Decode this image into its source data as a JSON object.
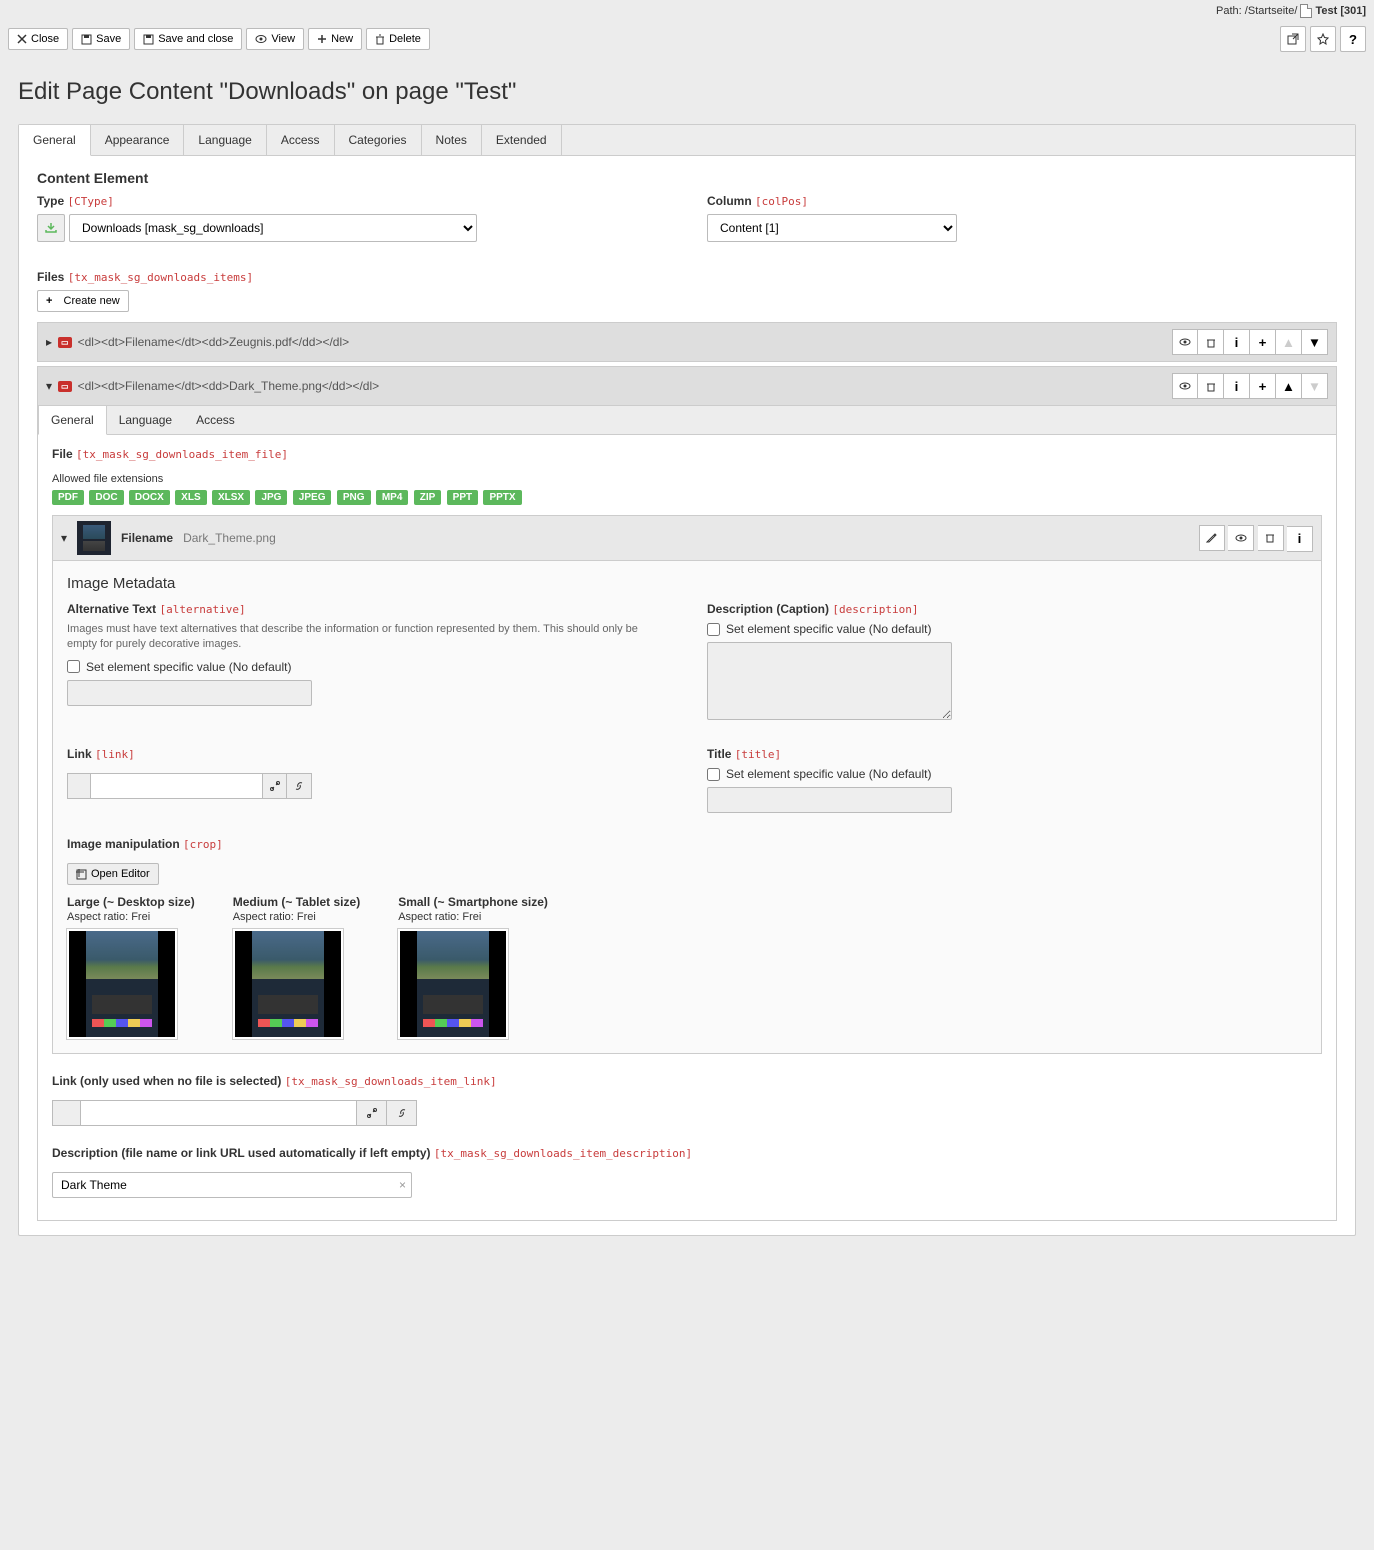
{
  "path": {
    "label": "Path:",
    "segment": "/Startseite/",
    "page": "Test",
    "uid": "[301]"
  },
  "toolbar": {
    "close": "Close",
    "save": "Save",
    "save_close": "Save and close",
    "view": "View",
    "new": "New",
    "delete": "Delete"
  },
  "heading": "Edit Page Content \"Downloads\" on page \"Test\"",
  "tabs": [
    "General",
    "Appearance",
    "Language",
    "Access",
    "Categories",
    "Notes",
    "Extended"
  ],
  "section_label": "Content Element",
  "type": {
    "label": "Type",
    "code": "[CType]",
    "value": "Downloads [mask_sg_downloads]"
  },
  "column": {
    "label": "Column",
    "code": "[colPos]",
    "value": "Content [1]"
  },
  "files": {
    "label": "Files",
    "code": "[tx_mask_sg_downloads_items]",
    "create": "Create new"
  },
  "collapsed_item": "<dl><dt>Filename</dt><dd>Zeugnis.pdf</dd></dl>",
  "expanded_item": "<dl><dt>Filename</dt><dd>Dark_Theme.png</dd></dl>",
  "sub_tabs": [
    "General",
    "Language",
    "Access"
  ],
  "file_field": {
    "label": "File",
    "code": "[tx_mask_sg_downloads_item_file]",
    "allowed_label": "Allowed file extensions",
    "ext": [
      "PDF",
      "DOC",
      "DOCX",
      "XLS",
      "XLSX",
      "JPG",
      "JPEG",
      "PNG",
      "MP4",
      "ZIP",
      "PPT",
      "PPTX"
    ]
  },
  "file_row": {
    "fn_label": "Filename",
    "fn": "Dark_Theme.png"
  },
  "meta": {
    "heading": "Image Metadata",
    "alt": {
      "label": "Alternative Text",
      "code": "[alternative]",
      "help": "Images must have text alternatives that describe the information or function represented by them. This should only be empty for purely decorative images.",
      "override": "Set element specific value (No default)"
    },
    "desc": {
      "label": "Description (Caption)",
      "code": "[description]",
      "override": "Set element specific value (No default)"
    },
    "link": {
      "label": "Link",
      "code": "[link]"
    },
    "title": {
      "label": "Title",
      "code": "[title]",
      "override": "Set element specific value (No default)"
    },
    "crop": {
      "label": "Image manipulation",
      "code": "[crop]",
      "open": "Open Editor",
      "variants": [
        {
          "title": "Large (~ Desktop size)",
          "ratio": "Aspect ratio: Frei"
        },
        {
          "title": "Medium (~ Tablet size)",
          "ratio": "Aspect ratio: Frei"
        },
        {
          "title": "Small (~ Smartphone size)",
          "ratio": "Aspect ratio: Frei"
        }
      ]
    }
  },
  "link_field": {
    "label": "Link (only used when no file is selected)",
    "code": "[tx_mask_sg_downloads_item_link]"
  },
  "desc_field": {
    "label": "Description (file name or link URL used automatically if left empty)",
    "code": "[tx_mask_sg_downloads_item_description]",
    "value": "Dark Theme"
  }
}
